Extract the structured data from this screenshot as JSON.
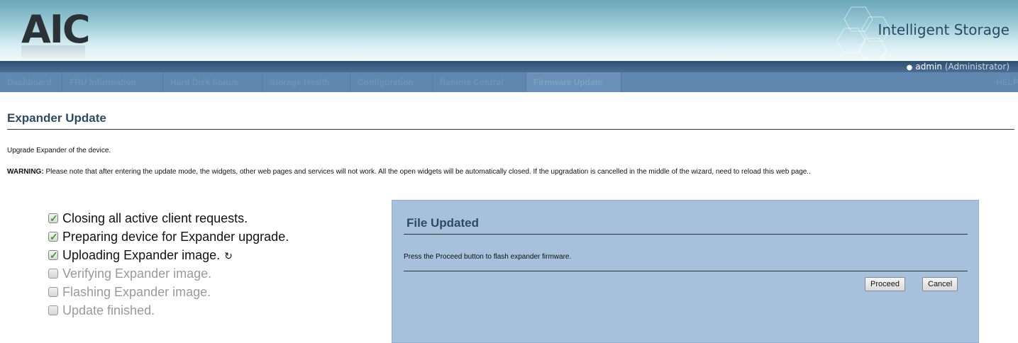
{
  "header": {
    "logo": "AIC",
    "brand": "Intelligent Storage",
    "user": {
      "name": "admin",
      "role": "(Administrator)"
    }
  },
  "nav": {
    "items": [
      {
        "label": "Dashboard"
      },
      {
        "label": "FRU Information"
      },
      {
        "label": "Hard Disk Status"
      },
      {
        "label": "Storage Health"
      },
      {
        "label": "Configuration"
      },
      {
        "label": "Remote Control"
      },
      {
        "label": "Firmware Update"
      }
    ],
    "help": "HELP"
  },
  "page": {
    "title": "Expander Update",
    "description": "Upgrade Expander of the device.",
    "warning_label": "WARNING:",
    "warning_text": " Please note that after entering the update mode, the widgets, other web pages and services will not work. All the open widgets will be automatically closed. If the upgradation is cancelled in the middle of the wizard, need to reload this web page.."
  },
  "steps": [
    {
      "label": "Closing all active client requests.",
      "checked": true
    },
    {
      "label": "Preparing device for Expander upgrade.",
      "checked": true
    },
    {
      "label": "Uploading Expander image.",
      "checked": true
    },
    {
      "label": "Verifying Expander image.",
      "checked": false
    },
    {
      "label": "Flashing Expander image.",
      "checked": false
    },
    {
      "label": "Update finished.",
      "checked": false
    }
  ],
  "dialog": {
    "title": "File Updated",
    "message": "Press the Proceed button to flash expander firmware.",
    "proceed_label": "Proceed",
    "cancel_label": "Cancel"
  },
  "colors": {
    "nav_bg": "#5f87b0",
    "panel_bg": "#a7c1dc",
    "title_color": "#2f4b62"
  }
}
